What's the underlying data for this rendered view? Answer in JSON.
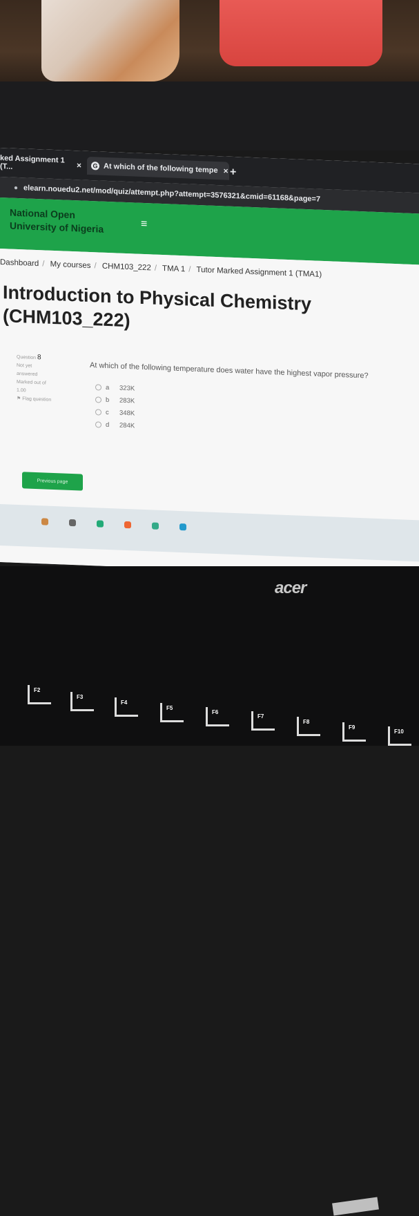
{
  "browser": {
    "tab1_title": "ked Assignment 1 (T...",
    "tab2_title": "At which of the following tempe",
    "tab_close": "×",
    "new_tab": "+",
    "url": "elearn.nouedu2.net/mod/quiz/attempt.php?attempt=3576321&cmid=61168&page=7"
  },
  "header": {
    "logo_line1": "National Open",
    "logo_line2": "University of Nigeria",
    "menu_icon": "≡"
  },
  "breadcrumb": [
    "Dashboard",
    "My courses",
    "CHM103_222",
    "TMA 1",
    "Tutor Marked Assignment 1 (TMA1)"
  ],
  "course": {
    "title_line1": "Introduction to Physical Chemistry",
    "title_line2": "(CHM103_222)"
  },
  "question_info": {
    "label": "Question",
    "number": "8",
    "status_line1": "Not yet",
    "status_line2": "answered",
    "marked_line1": "Marked out of",
    "marked_line2": "1.00",
    "flag": "Flag question"
  },
  "question": {
    "text": "At which of the following temperature does water have the highest vapor pressure?",
    "options": [
      {
        "letter": "a",
        "value": "323K"
      },
      {
        "letter": "b",
        "value": "283K"
      },
      {
        "letter": "c",
        "value": "348K"
      },
      {
        "letter": "d",
        "value": "284K"
      }
    ]
  },
  "navigation": {
    "previous_label": "Previous page"
  },
  "laptop": {
    "brand": "acer",
    "keys": [
      "F2",
      "F3",
      "F4",
      "F5",
      "F6",
      "F7",
      "F8",
      "F9",
      "F10"
    ]
  }
}
